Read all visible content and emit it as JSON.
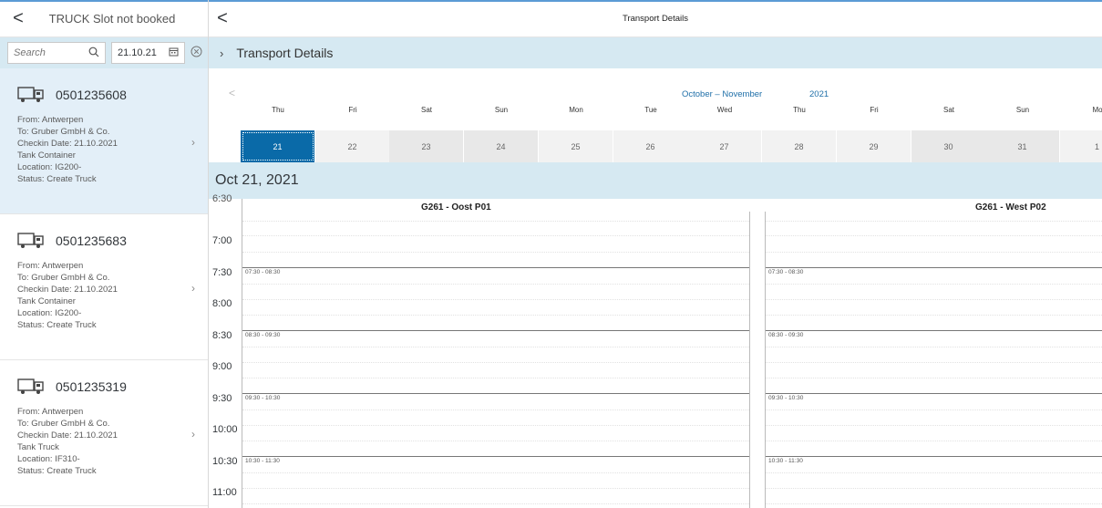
{
  "master": {
    "back_label": "<",
    "title": "TRUCK Slot not booked",
    "search": {
      "placeholder": "Search",
      "icon": "search-icon"
    },
    "date_filter": {
      "value": "21.10.21",
      "icon": "calendar-icon"
    },
    "items": [
      {
        "number": "0501235608",
        "from": "From: Antwerpen",
        "to": "To: Gruber GmbH & Co.",
        "checkin": "Checkin Date: 21.10.2021",
        "type": "Tank Container",
        "location": "Location: IG200-",
        "status": "Status: Create Truck"
      },
      {
        "number": "0501235683",
        "from": "From: Antwerpen",
        "to": "To: Gruber GmbH & Co.",
        "checkin": "Checkin Date: 21.10.2021",
        "type": "Tank Container",
        "location": "Location: IG200-",
        "status": "Status: Create Truck"
      },
      {
        "number": "0501235319",
        "from": "From: Antwerpen",
        "to": "To: Gruber GmbH & Co.",
        "checkin": "Checkin Date: 21.10.2021",
        "type": "Tank Truck",
        "location": "Location: IF310-",
        "status": "Status: Create Truck"
      }
    ]
  },
  "detail": {
    "back_label": "<",
    "title": "Transport Details",
    "section_label": "Transport Details",
    "calendar": {
      "prev_label": "<",
      "month_range": "October – November",
      "year": "2021",
      "day_names": [
        "Thu",
        "Fri",
        "Sat",
        "Sun",
        "Mon",
        "Tue",
        "Wed",
        "Thu",
        "Fri",
        "Sat",
        "Sun",
        "Mo"
      ],
      "days": [
        "21",
        "22",
        "23",
        "24",
        "25",
        "26",
        "27",
        "28",
        "29",
        "30",
        "31",
        "1"
      ],
      "selected_day": "21"
    },
    "selected_date_label": "Oct 21, 2021",
    "schedule": {
      "cut_time_label": "6:30",
      "time_labels": [
        "7:00",
        "7:30",
        "8:00",
        "8:30",
        "9:00",
        "9:30",
        "10:00",
        "10:30",
        "11:00"
      ],
      "columns": [
        {
          "title": "G261 - Oost P01"
        },
        {
          "title": "G261 - West P02"
        }
      ],
      "slots": [
        "07:30 - 08:30",
        "08:30 - 09:30",
        "09:30 - 10:30",
        "10:30 - 11:30"
      ]
    }
  },
  "colors": {
    "accent": "#0a6aa8",
    "bar_bg": "#d6e9f2",
    "selected_item_bg": "#e3eff8"
  }
}
